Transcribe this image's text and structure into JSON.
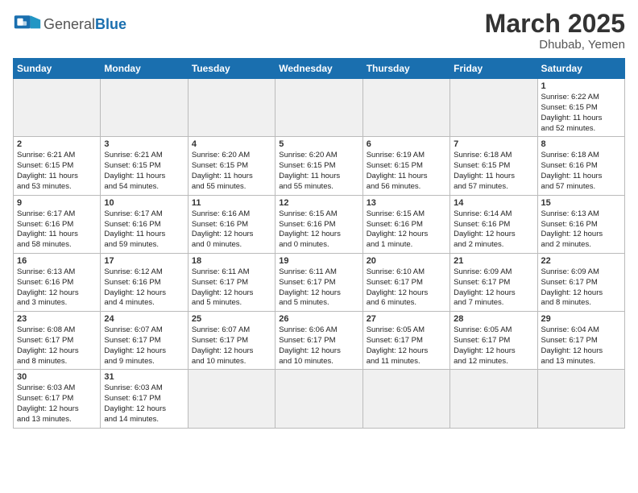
{
  "header": {
    "logo_general": "General",
    "logo_blue": "Blue",
    "month_title": "March 2025",
    "location": "Dhubab, Yemen"
  },
  "weekdays": [
    "Sunday",
    "Monday",
    "Tuesday",
    "Wednesday",
    "Thursday",
    "Friday",
    "Saturday"
  ],
  "weeks": [
    [
      {
        "day": "",
        "empty": true
      },
      {
        "day": "",
        "empty": true
      },
      {
        "day": "",
        "empty": true
      },
      {
        "day": "",
        "empty": true
      },
      {
        "day": "",
        "empty": true
      },
      {
        "day": "",
        "empty": true
      },
      {
        "day": "1",
        "info": "Sunrise: 6:22 AM\nSunset: 6:15 PM\nDaylight: 11 hours\nand 52 minutes."
      }
    ],
    [
      {
        "day": "2",
        "info": "Sunrise: 6:21 AM\nSunset: 6:15 PM\nDaylight: 11 hours\nand 53 minutes."
      },
      {
        "day": "3",
        "info": "Sunrise: 6:21 AM\nSunset: 6:15 PM\nDaylight: 11 hours\nand 54 minutes."
      },
      {
        "day": "4",
        "info": "Sunrise: 6:20 AM\nSunset: 6:15 PM\nDaylight: 11 hours\nand 55 minutes."
      },
      {
        "day": "5",
        "info": "Sunrise: 6:20 AM\nSunset: 6:15 PM\nDaylight: 11 hours\nand 55 minutes."
      },
      {
        "day": "6",
        "info": "Sunrise: 6:19 AM\nSunset: 6:15 PM\nDaylight: 11 hours\nand 56 minutes."
      },
      {
        "day": "7",
        "info": "Sunrise: 6:18 AM\nSunset: 6:15 PM\nDaylight: 11 hours\nand 57 minutes."
      },
      {
        "day": "8",
        "info": "Sunrise: 6:18 AM\nSunset: 6:16 PM\nDaylight: 11 hours\nand 57 minutes."
      }
    ],
    [
      {
        "day": "9",
        "info": "Sunrise: 6:17 AM\nSunset: 6:16 PM\nDaylight: 11 hours\nand 58 minutes."
      },
      {
        "day": "10",
        "info": "Sunrise: 6:17 AM\nSunset: 6:16 PM\nDaylight: 11 hours\nand 59 minutes."
      },
      {
        "day": "11",
        "info": "Sunrise: 6:16 AM\nSunset: 6:16 PM\nDaylight: 12 hours\nand 0 minutes."
      },
      {
        "day": "12",
        "info": "Sunrise: 6:15 AM\nSunset: 6:16 PM\nDaylight: 12 hours\nand 0 minutes."
      },
      {
        "day": "13",
        "info": "Sunrise: 6:15 AM\nSunset: 6:16 PM\nDaylight: 12 hours\nand 1 minute."
      },
      {
        "day": "14",
        "info": "Sunrise: 6:14 AM\nSunset: 6:16 PM\nDaylight: 12 hours\nand 2 minutes."
      },
      {
        "day": "15",
        "info": "Sunrise: 6:13 AM\nSunset: 6:16 PM\nDaylight: 12 hours\nand 2 minutes."
      }
    ],
    [
      {
        "day": "16",
        "info": "Sunrise: 6:13 AM\nSunset: 6:16 PM\nDaylight: 12 hours\nand 3 minutes."
      },
      {
        "day": "17",
        "info": "Sunrise: 6:12 AM\nSunset: 6:16 PM\nDaylight: 12 hours\nand 4 minutes."
      },
      {
        "day": "18",
        "info": "Sunrise: 6:11 AM\nSunset: 6:17 PM\nDaylight: 12 hours\nand 5 minutes."
      },
      {
        "day": "19",
        "info": "Sunrise: 6:11 AM\nSunset: 6:17 PM\nDaylight: 12 hours\nand 5 minutes."
      },
      {
        "day": "20",
        "info": "Sunrise: 6:10 AM\nSunset: 6:17 PM\nDaylight: 12 hours\nand 6 minutes."
      },
      {
        "day": "21",
        "info": "Sunrise: 6:09 AM\nSunset: 6:17 PM\nDaylight: 12 hours\nand 7 minutes."
      },
      {
        "day": "22",
        "info": "Sunrise: 6:09 AM\nSunset: 6:17 PM\nDaylight: 12 hours\nand 8 minutes."
      }
    ],
    [
      {
        "day": "23",
        "info": "Sunrise: 6:08 AM\nSunset: 6:17 PM\nDaylight: 12 hours\nand 8 minutes."
      },
      {
        "day": "24",
        "info": "Sunrise: 6:07 AM\nSunset: 6:17 PM\nDaylight: 12 hours\nand 9 minutes."
      },
      {
        "day": "25",
        "info": "Sunrise: 6:07 AM\nSunset: 6:17 PM\nDaylight: 12 hours\nand 10 minutes."
      },
      {
        "day": "26",
        "info": "Sunrise: 6:06 AM\nSunset: 6:17 PM\nDaylight: 12 hours\nand 10 minutes."
      },
      {
        "day": "27",
        "info": "Sunrise: 6:05 AM\nSunset: 6:17 PM\nDaylight: 12 hours\nand 11 minutes."
      },
      {
        "day": "28",
        "info": "Sunrise: 6:05 AM\nSunset: 6:17 PM\nDaylight: 12 hours\nand 12 minutes."
      },
      {
        "day": "29",
        "info": "Sunrise: 6:04 AM\nSunset: 6:17 PM\nDaylight: 12 hours\nand 13 minutes."
      }
    ],
    [
      {
        "day": "30",
        "info": "Sunrise: 6:03 AM\nSunset: 6:17 PM\nDaylight: 12 hours\nand 13 minutes."
      },
      {
        "day": "31",
        "info": "Sunrise: 6:03 AM\nSunset: 6:17 PM\nDaylight: 12 hours\nand 14 minutes."
      },
      {
        "day": "",
        "empty": true
      },
      {
        "day": "",
        "empty": true
      },
      {
        "day": "",
        "empty": true
      },
      {
        "day": "",
        "empty": true
      },
      {
        "day": "",
        "empty": true
      }
    ]
  ]
}
